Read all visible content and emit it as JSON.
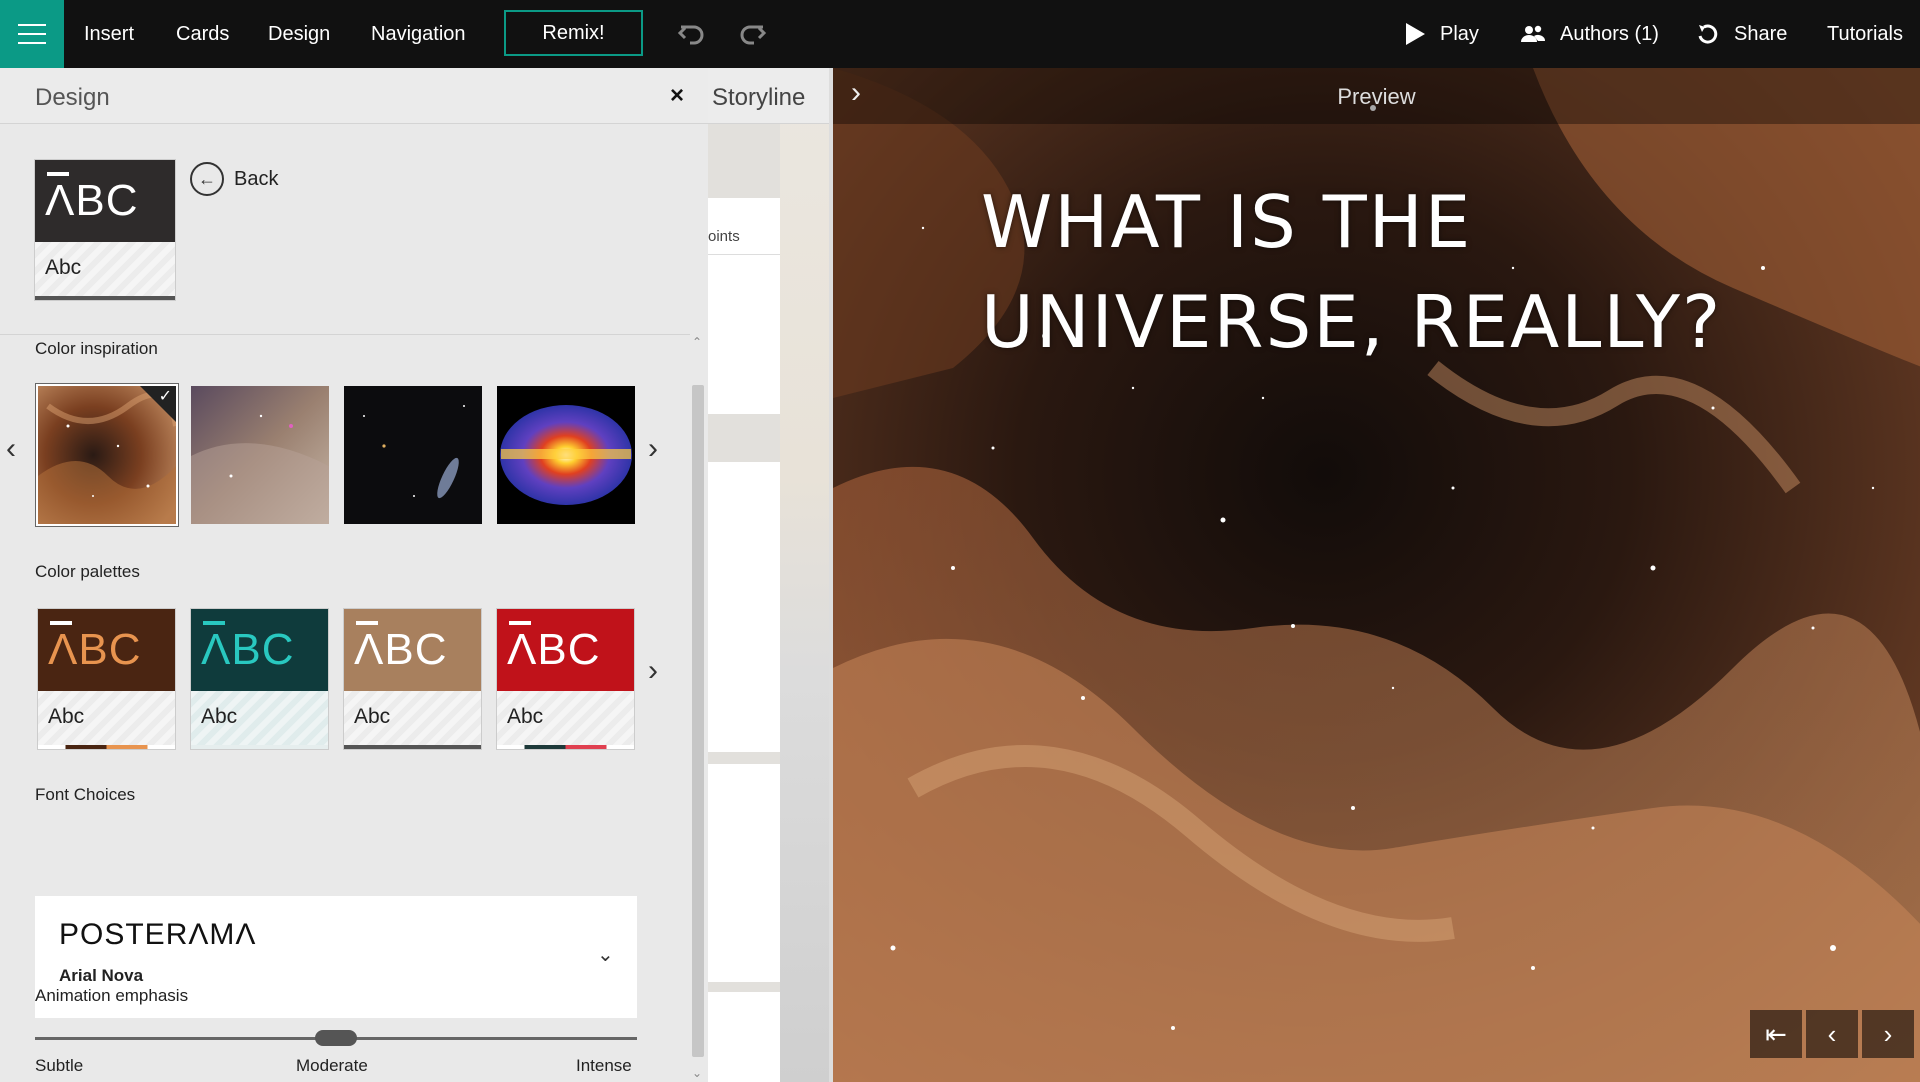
{
  "topbar": {
    "menu": [
      "Insert",
      "Cards",
      "Design",
      "Navigation"
    ],
    "remix_label": "Remix!",
    "play_label": "Play",
    "authors_label": "Authors (1)",
    "share_label": "Share",
    "tutorials_label": "Tutorials",
    "accent_color": "#0b9a86"
  },
  "design_panel": {
    "title": "Design",
    "close_label": "×",
    "back_label": "Back",
    "current_theme": {
      "big": "ΛBC",
      "small": "Abc"
    },
    "color_inspiration_label": "Color inspiration",
    "color_inspiration_images": [
      "nebula-image",
      "purple-dust-image",
      "galaxy-image",
      "radiation-map-image"
    ],
    "color_palettes_label": "Color palettes",
    "palettes": [
      {
        "big": "ΛBC",
        "small": "Abc",
        "bg": "#4a2512",
        "accent": "#e8944f"
      },
      {
        "big": "ΛBC",
        "small": "Abc",
        "bg": "#0f3b3c",
        "accent": "#29c8c0"
      },
      {
        "big": "ΛBC",
        "small": "Abc",
        "bg": "#a8805e",
        "accent": "#ffffff"
      },
      {
        "big": "ΛBC",
        "small": "Abc",
        "bg": "#c0121a",
        "accent": "#1e8a86"
      }
    ],
    "font_choices_label": "Font Choices",
    "font_primary": "POSTERΛMΛ",
    "font_secondary": "Arial Nova",
    "animation_label": "Animation emphasis",
    "animation_levels": [
      "Subtle",
      "Moderate",
      "Intense"
    ],
    "animation_value": "Moderate"
  },
  "storyline": {
    "title": "Storyline",
    "card_label": "Points"
  },
  "preview": {
    "label": "Preview",
    "title": "WHAT IS THE UNIVERSE, REALLY?"
  }
}
